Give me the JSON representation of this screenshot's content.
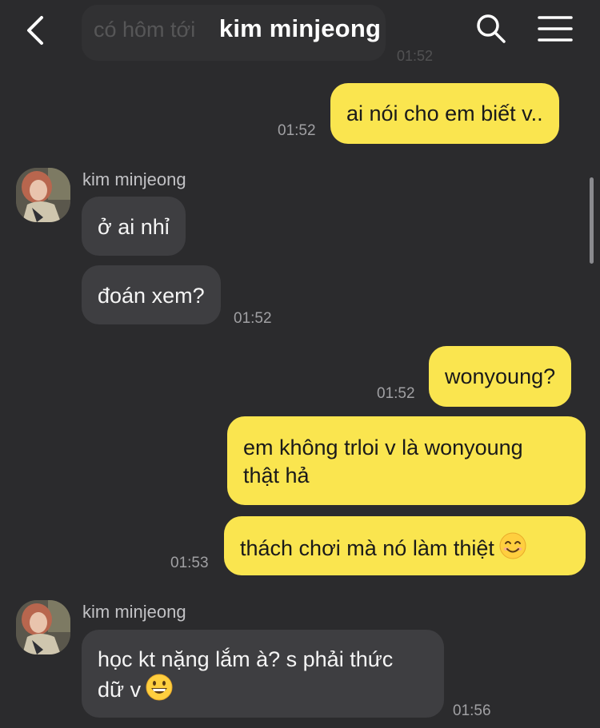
{
  "header": {
    "title": "kim minjeong",
    "ghost_text": "có hôm tới",
    "ghost_time": "01:52",
    "back_icon": "back-chevron-icon",
    "search_icon": "search-icon",
    "menu_icon": "menu-icon"
  },
  "colors": {
    "background": "#2b2b2d",
    "incoming_bubble": "#3e3e41",
    "outgoing_bubble": "#fae54f"
  },
  "messages": [
    {
      "direction": "out",
      "text": "ai nói cho em biết v..",
      "time": "01:52"
    },
    {
      "direction": "in",
      "sender": "kim minjeong",
      "text": "ở ai nhỉ",
      "time": ""
    },
    {
      "direction": "in",
      "text": "đoán xem?",
      "time": "01:52"
    },
    {
      "direction": "out",
      "text": "wonyoung?",
      "time": "01:52"
    },
    {
      "direction": "out",
      "lines": [
        "em không trloi v là wonyoung",
        "thật hả"
      ],
      "time": ""
    },
    {
      "direction": "out",
      "text": "thách chơi mà nó làm thiệt",
      "emoji": "smiling-face-emoji",
      "time": "01:53"
    },
    {
      "direction": "in",
      "sender": "kim minjeong",
      "lines": [
        "học kt nặng lắm à? s phải thức",
        "dữ v"
      ],
      "emoji": "grinning-face-emoji",
      "time": "01:56"
    }
  ]
}
